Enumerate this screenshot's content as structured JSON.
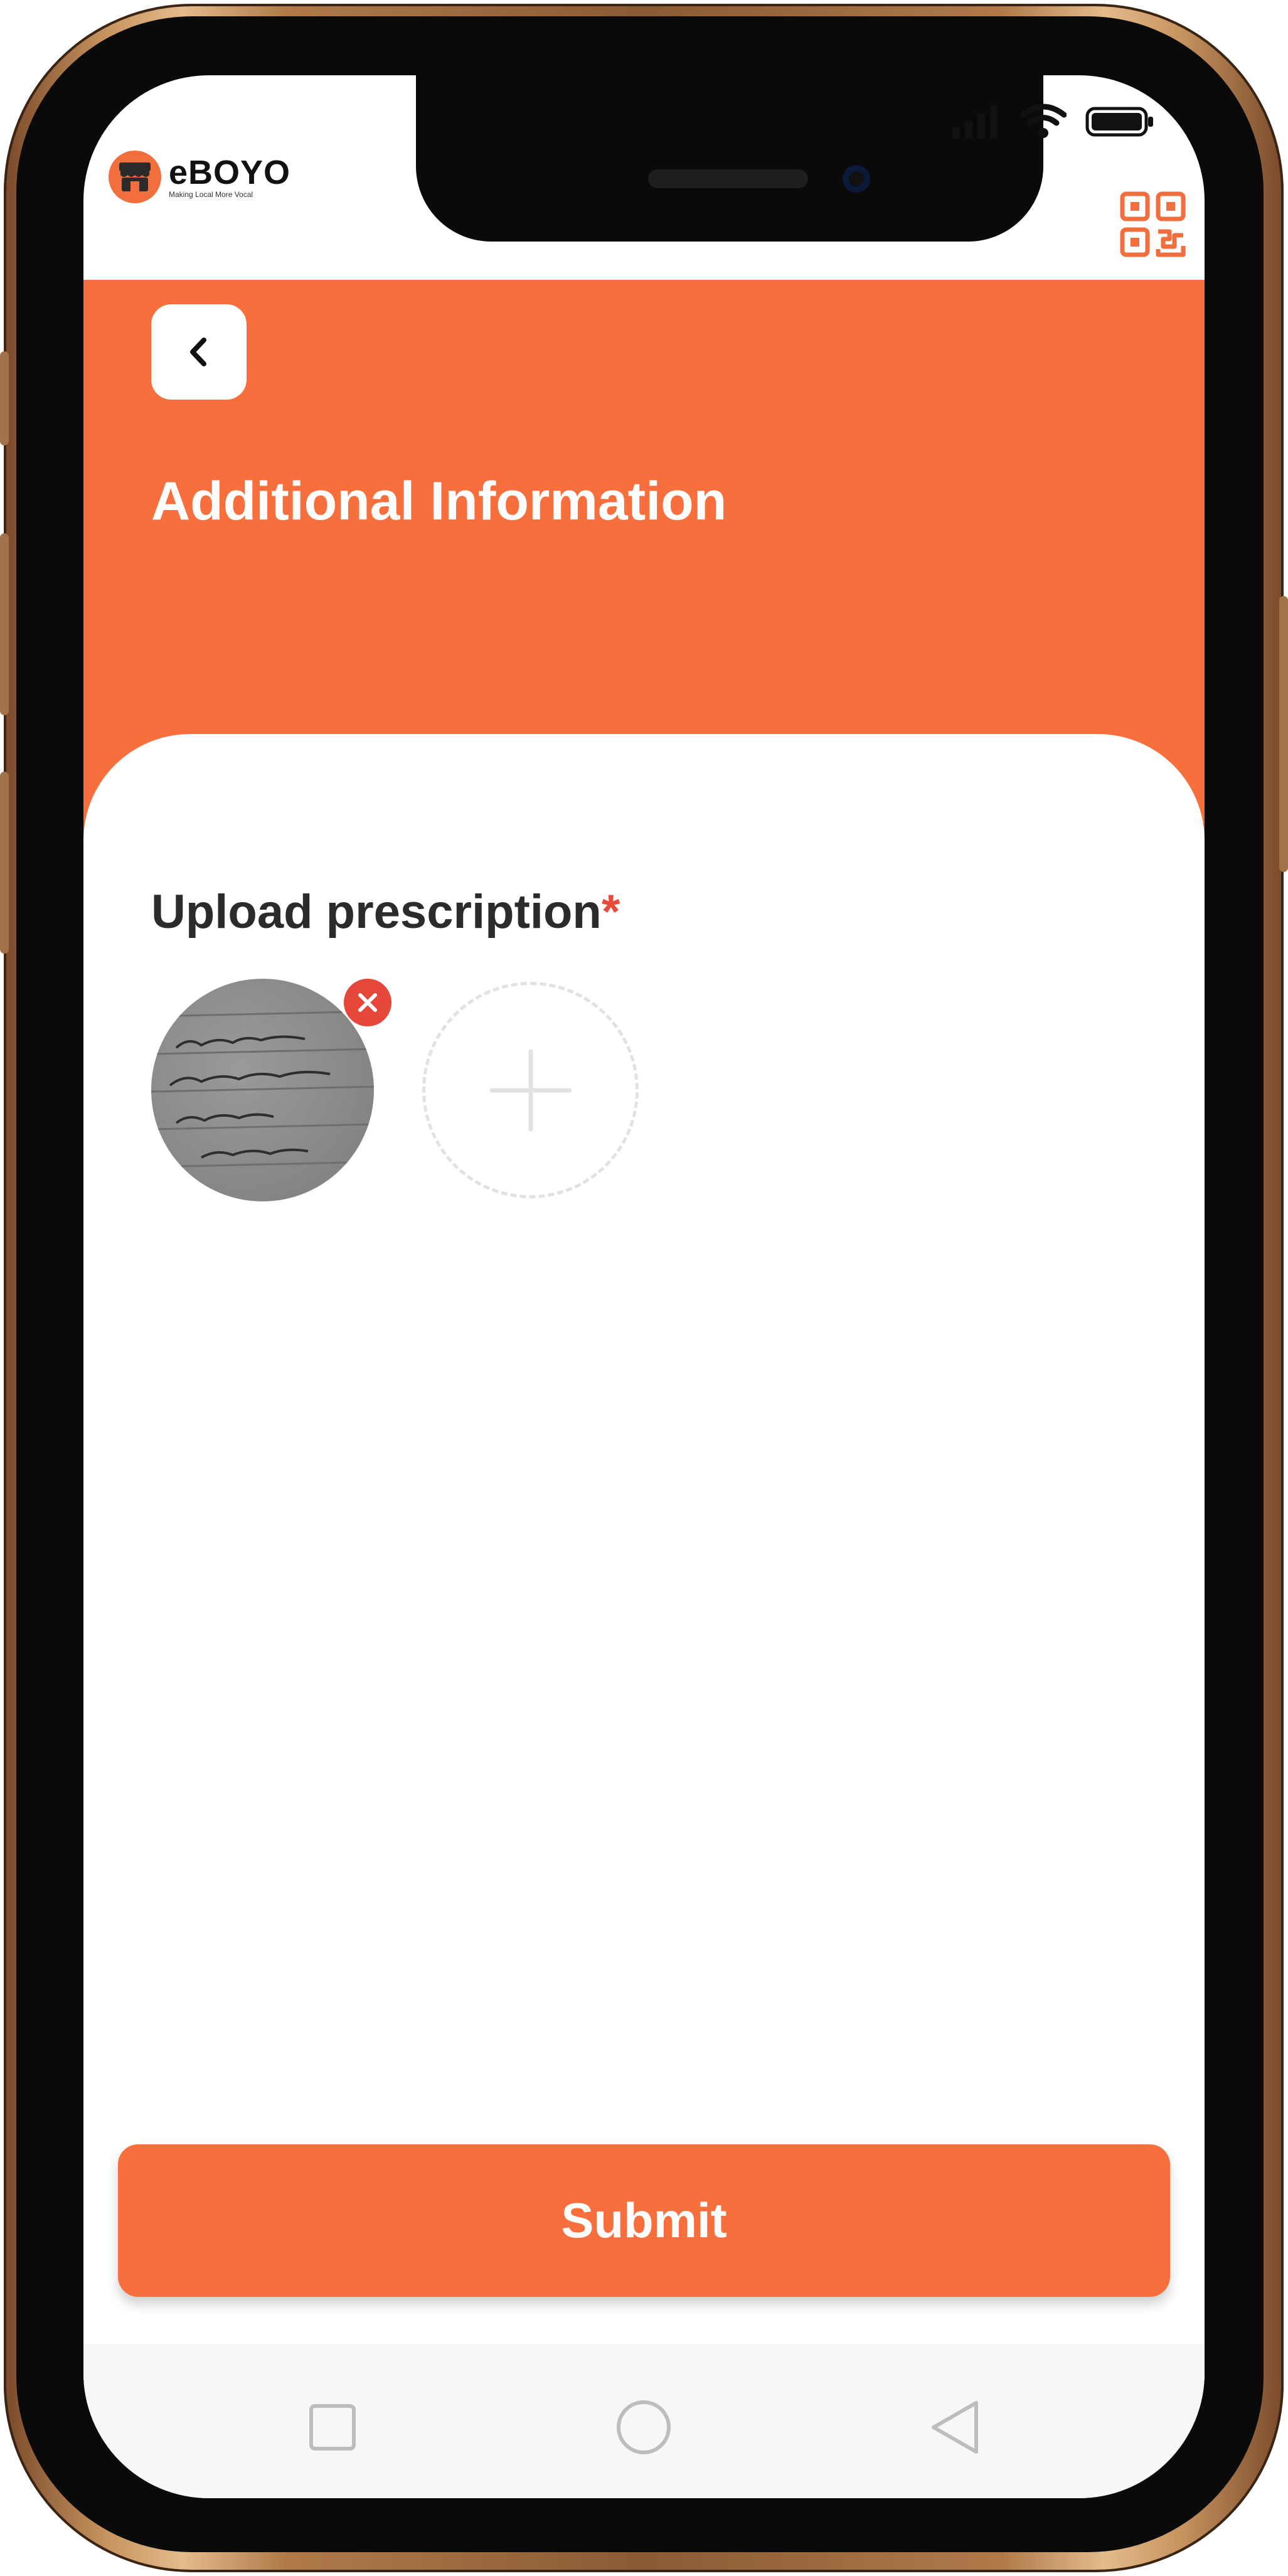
{
  "app": {
    "brand_name": "eBOYO",
    "brand_tagline": "Making Local More Vocal"
  },
  "header": {
    "title": "Additional Information"
  },
  "form": {
    "upload_label": "Upload prescription",
    "required_marker": "*",
    "uploaded_images": [
      {
        "description_icon": "prescription-photo"
      }
    ]
  },
  "actions": {
    "submit_label": "Submit"
  },
  "colors": {
    "accent": "#f86f3e",
    "remove": "#e6473b",
    "title_text": "#ffffff",
    "label_text": "#2b2b2b"
  },
  "icons": {
    "back": "chevron-left-icon",
    "qr": "qr-code-icon",
    "remove": "close-icon",
    "add": "plus-icon",
    "nav_recent": "square-icon",
    "nav_home": "circle-icon",
    "nav_back": "triangle-back-icon"
  }
}
